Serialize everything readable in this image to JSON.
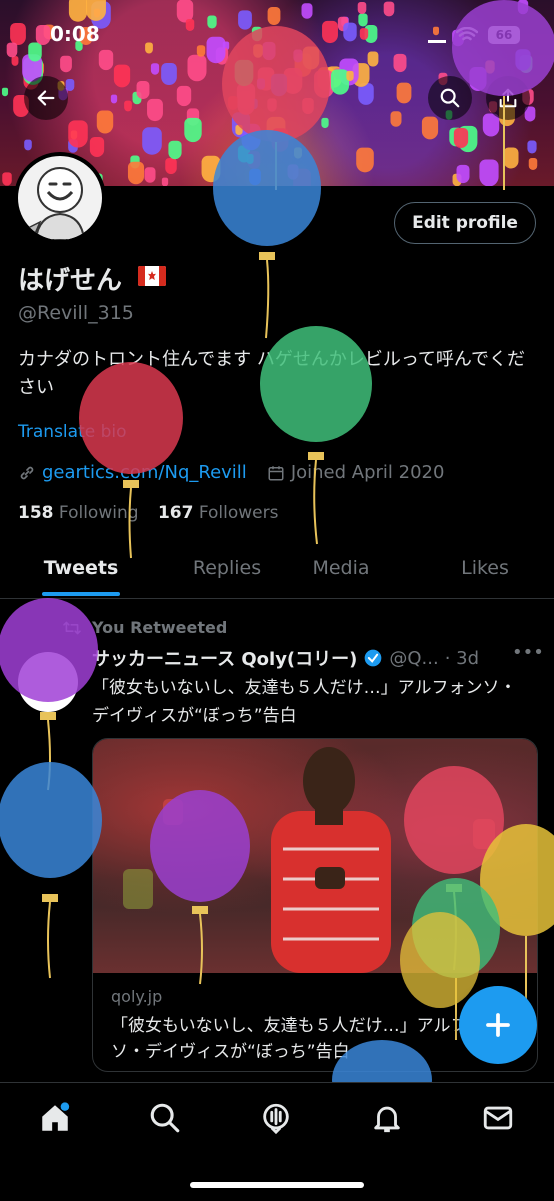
{
  "status_bar": {
    "time": "0:08",
    "battery": "66"
  },
  "profile": {
    "display_name": "はげせん",
    "handle": "@Revill_315",
    "bio": "カナダのトロント住んでます ハゲせんかレビルって呼んでください",
    "translate_label": "Translate bio",
    "link_text": "geartics.com/Nq_Revill",
    "joined": "Joined April 2020",
    "following_count": "158",
    "following_label": "Following",
    "followers_count": "167",
    "followers_label": "Followers",
    "edit_button": "Edit profile"
  },
  "tabs": [
    {
      "label": "Tweets",
      "active": true
    },
    {
      "label": "Replies",
      "active": false
    },
    {
      "label": "Media",
      "active": false
    },
    {
      "label": "Likes",
      "active": false
    }
  ],
  "tweet": {
    "retweet_label": "You Retweeted",
    "name": "サッカーニュース Qoly(コリー)",
    "handle": "@Q...",
    "time": "· 3d",
    "text": "「彼女もいないし、友達も５人だけ…」アルフォンソ・デイヴィスが“ぼっち”告白",
    "card_domain": "qoly.jp",
    "card_title": "「彼女もいないし、友達も５人だけ…」アルフォンソ・デイヴィスが“ぼっち”告白"
  },
  "icons": {
    "back": "arrow-left-icon",
    "search": "search-icon",
    "share": "share-icon",
    "link": "link-icon",
    "calendar": "calendar-icon",
    "retweet": "retweet-icon",
    "verified": "verified-badge-icon",
    "more": "more-icon",
    "compose": "plus-icon",
    "nav": [
      "home-icon",
      "search-icon",
      "spaces-icon",
      "notifications-icon",
      "messages-icon"
    ]
  },
  "colors": {
    "accent": "#1d9bf0",
    "background": "#000000",
    "text": "#e7e9ea",
    "secondary_text": "#71767b"
  }
}
